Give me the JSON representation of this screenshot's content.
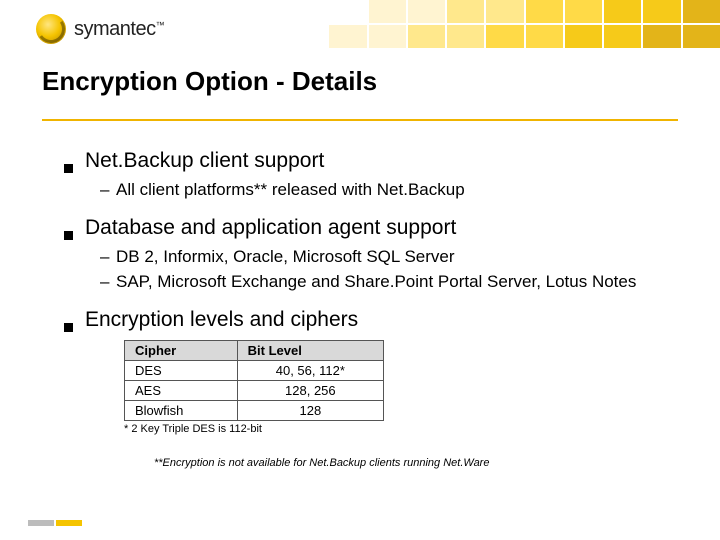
{
  "brand": {
    "name": "symantec",
    "tm": "™"
  },
  "title": "Encryption Option - Details",
  "bullets": [
    {
      "text": "Net.Backup client support",
      "sub": [
        "All client platforms** released with Net.Backup"
      ]
    },
    {
      "text": "Database and application agent support",
      "sub": [
        "DB 2, Informix, Oracle, Microsoft SQL Server",
        "SAP, Microsoft Exchange and Share.Point Portal Server, Lotus Notes"
      ]
    },
    {
      "text": "Encryption levels and ciphers",
      "sub": []
    }
  ],
  "cipher_table": {
    "headers": [
      "Cipher",
      "Bit Level"
    ],
    "rows": [
      [
        "DES",
        "40, 56, 112*"
      ],
      [
        "AES",
        "128, 256"
      ],
      [
        "Blowfish",
        "128"
      ]
    ],
    "note": "* 2 Key Triple DES is 112-bit"
  },
  "footnote": "**Encryption is not available for Net.Backup clients running Net.Ware",
  "chart_data": {
    "type": "table",
    "title": "Encryption levels and ciphers",
    "columns": [
      "Cipher",
      "Bit Level"
    ],
    "rows": [
      {
        "Cipher": "DES",
        "Bit Level": "40, 56, 112*"
      },
      {
        "Cipher": "AES",
        "Bit Level": "128, 256"
      },
      {
        "Cipher": "Blowfish",
        "Bit Level": "128"
      }
    ],
    "note": "* 2 Key Triple DES is 112-bit"
  }
}
